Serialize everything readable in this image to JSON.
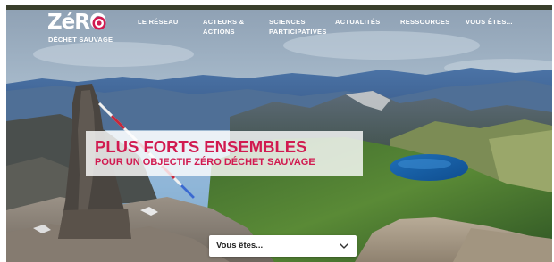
{
  "logo": {
    "wordmark": "ZéRO",
    "tagline": "DÉCHET SAUVAGE",
    "target_colors": [
      "#d11a50",
      "#ffffff"
    ]
  },
  "nav": {
    "items": [
      {
        "label": "LE RÉSEAU"
      },
      {
        "label_line1": "ACTEURS &",
        "label_line2": "ACTIONS"
      },
      {
        "label_line1": "SCIENCES",
        "label_line2": "PARTICIPATIVES"
      },
      {
        "label": "ACTUALITÉS"
      },
      {
        "label": "RESSOURCES"
      },
      {
        "label": "VOUS ÊTES..."
      }
    ]
  },
  "hero": {
    "title": "PLUS FORTS ENSEMBLES",
    "subtitle": "POUR UN OBJECTIF ZÉRO DÉCHET SAUVAGE",
    "image_subject": "mountain-panorama-with-cairn-and-lake"
  },
  "profile_select": {
    "value": "Vous êtes...",
    "icon": "chevron-down-icon"
  },
  "colors": {
    "accent": "#d11a50",
    "nav_text": "#ffffff",
    "title_panel": "#ffffff"
  }
}
